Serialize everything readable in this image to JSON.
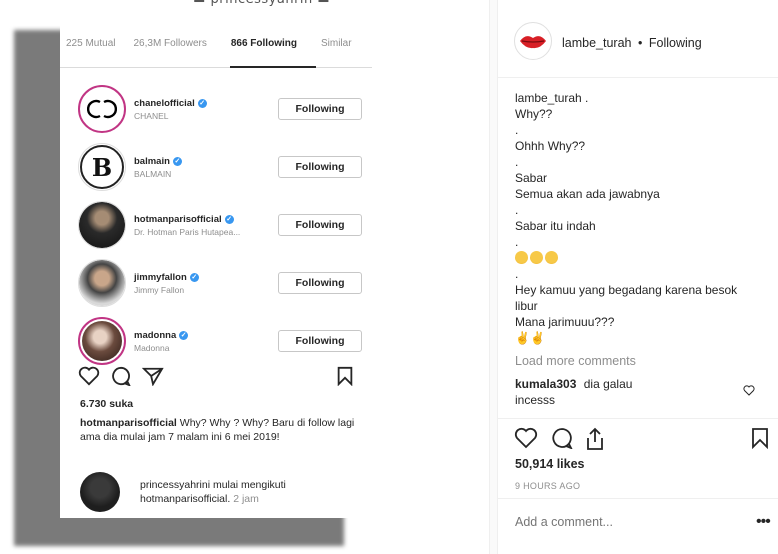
{
  "phone": {
    "tabs": [
      "225 Mutual",
      "26,3M Followers",
      "866 Following",
      "Similar"
    ],
    "following": [
      {
        "username": "chanelofficial",
        "fullname": "CHANEL",
        "button": "Following"
      },
      {
        "username": "balmain",
        "fullname": "BALMAIN",
        "button": "Following"
      },
      {
        "username": "hotmanparisofficial",
        "fullname": "Dr. Hotman Paris Hutapea...",
        "button": "Following"
      },
      {
        "username": "jimmyfallon",
        "fullname": "Jimmy Fallon",
        "button": "Following"
      },
      {
        "username": "madonna",
        "fullname": "Madonna",
        "button": "Following"
      }
    ],
    "likes": "6.730 suka",
    "caption_user": "hotmanparisofficial",
    "caption_text": "Why? Why ? Why? Baru di follow lagi ama dia mulai jam 7 malam ini 6 mei 2019!",
    "notif_text": "princessyahrini mulai mengikuti hotmanparisofficial.",
    "notif_time": "2 jam"
  },
  "post": {
    "username": "lambe_turah",
    "separator": "•",
    "follow_state": "Following",
    "comment_lines": [
      "lambe_turah .",
      "Why??",
      ".",
      "Ohhh Why??",
      ".",
      "Sabar",
      "Semua akan ada jawabnya",
      ".",
      "Sabar itu indah",
      ".",
      "EMOJI3",
      ".",
      "Hey kamuu yang begadang karena besok",
      "libur",
      "Mana jarimuuu???",
      "✌️✌️"
    ],
    "load_more": "Load more comments",
    "comment2_user": "kumala303",
    "comment2_text": "dia galau",
    "comment2_text2": "incesss",
    "likes": "50,914 likes",
    "time_ago": "9 HOURS AGO",
    "add_comment_placeholder": "Add a comment...",
    "more": "•••"
  }
}
